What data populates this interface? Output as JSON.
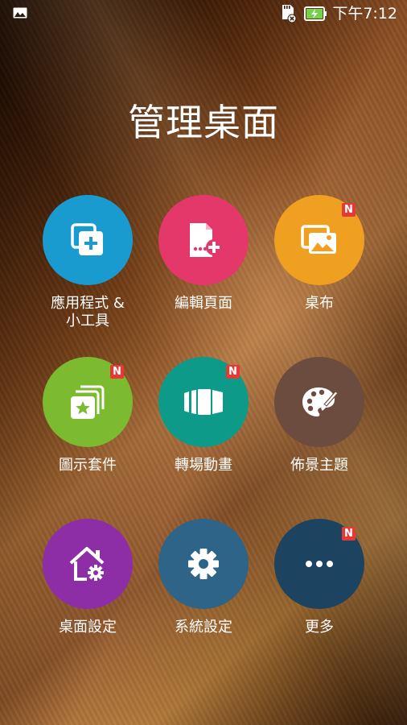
{
  "status_bar": {
    "time": "下午7:12",
    "icons": [
      "image-notification-icon",
      "sd-card-removed-icon",
      "battery-charging-icon"
    ]
  },
  "title": "管理桌面",
  "tiles": [
    {
      "label": "應用程式 &\n小工具",
      "icon": "add-widget-icon",
      "color": "#1a9bd0",
      "badge": ""
    },
    {
      "label": "編輯頁面",
      "icon": "edit-page-icon",
      "color": "#e5386a",
      "badge": ""
    },
    {
      "label": "桌布",
      "icon": "wallpaper-icon",
      "color": "#f0a020",
      "badge": "N"
    },
    {
      "label": "圖示套件",
      "icon": "icon-pack-icon",
      "color": "#7cba30",
      "badge": "N"
    },
    {
      "label": "轉場動畫",
      "icon": "transition-effect-icon",
      "color": "#0e9a88",
      "badge": "N"
    },
    {
      "label": "佈景主題",
      "icon": "theme-palette-icon",
      "color": "#6c4c3e",
      "badge": ""
    },
    {
      "label": "桌面設定",
      "icon": "home-settings-icon",
      "color": "#8e2ea6",
      "badge": ""
    },
    {
      "label": "系統設定",
      "icon": "gear-icon",
      "color": "#2e6488",
      "badge": ""
    },
    {
      "label": "更多",
      "icon": "more-icon",
      "color": "#1c4460",
      "badge": "N"
    }
  ]
}
